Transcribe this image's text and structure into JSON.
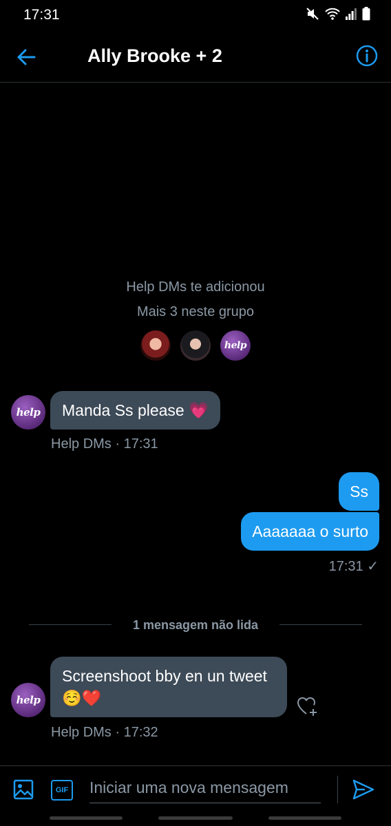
{
  "status_bar": {
    "time": "17:31",
    "icons": [
      "mute-icon",
      "wifi-icon",
      "signal-icon",
      "battery-icon"
    ]
  },
  "header": {
    "title": "Ally Brooke + 2",
    "back_icon": "arrow-left-icon",
    "info_icon": "info-icon"
  },
  "system": {
    "added_text": "Help DMs te adicionou",
    "more_text": "Mais 3 neste grupo",
    "group_avatar_label": "help"
  },
  "messages": [
    {
      "direction": "in",
      "sender_avatar": "help",
      "text": "Manda Ss please",
      "emoji": "💗",
      "meta": "Help DMs · 17:31"
    },
    {
      "direction": "out",
      "text": "Ss"
    },
    {
      "direction": "out",
      "text": "Aaaaaaa o surto",
      "meta": "17:31 ✓"
    },
    {
      "direction": "in",
      "sender_avatar": "help",
      "text_line1": "Screenshoot bby en un tweet",
      "text_line2": "☺️❤️",
      "meta": "Help DMs · 17:32"
    }
  ],
  "divider": {
    "text": "1 mensagem não lida"
  },
  "composer": {
    "placeholder": "Iniciar uma nova mensagem",
    "gif_label": "GIF"
  },
  "colors": {
    "accent": "#1d9bf0",
    "background": "#000000",
    "incoming_bubble": "#3d4a57",
    "muted_text": "#8b98a5"
  }
}
